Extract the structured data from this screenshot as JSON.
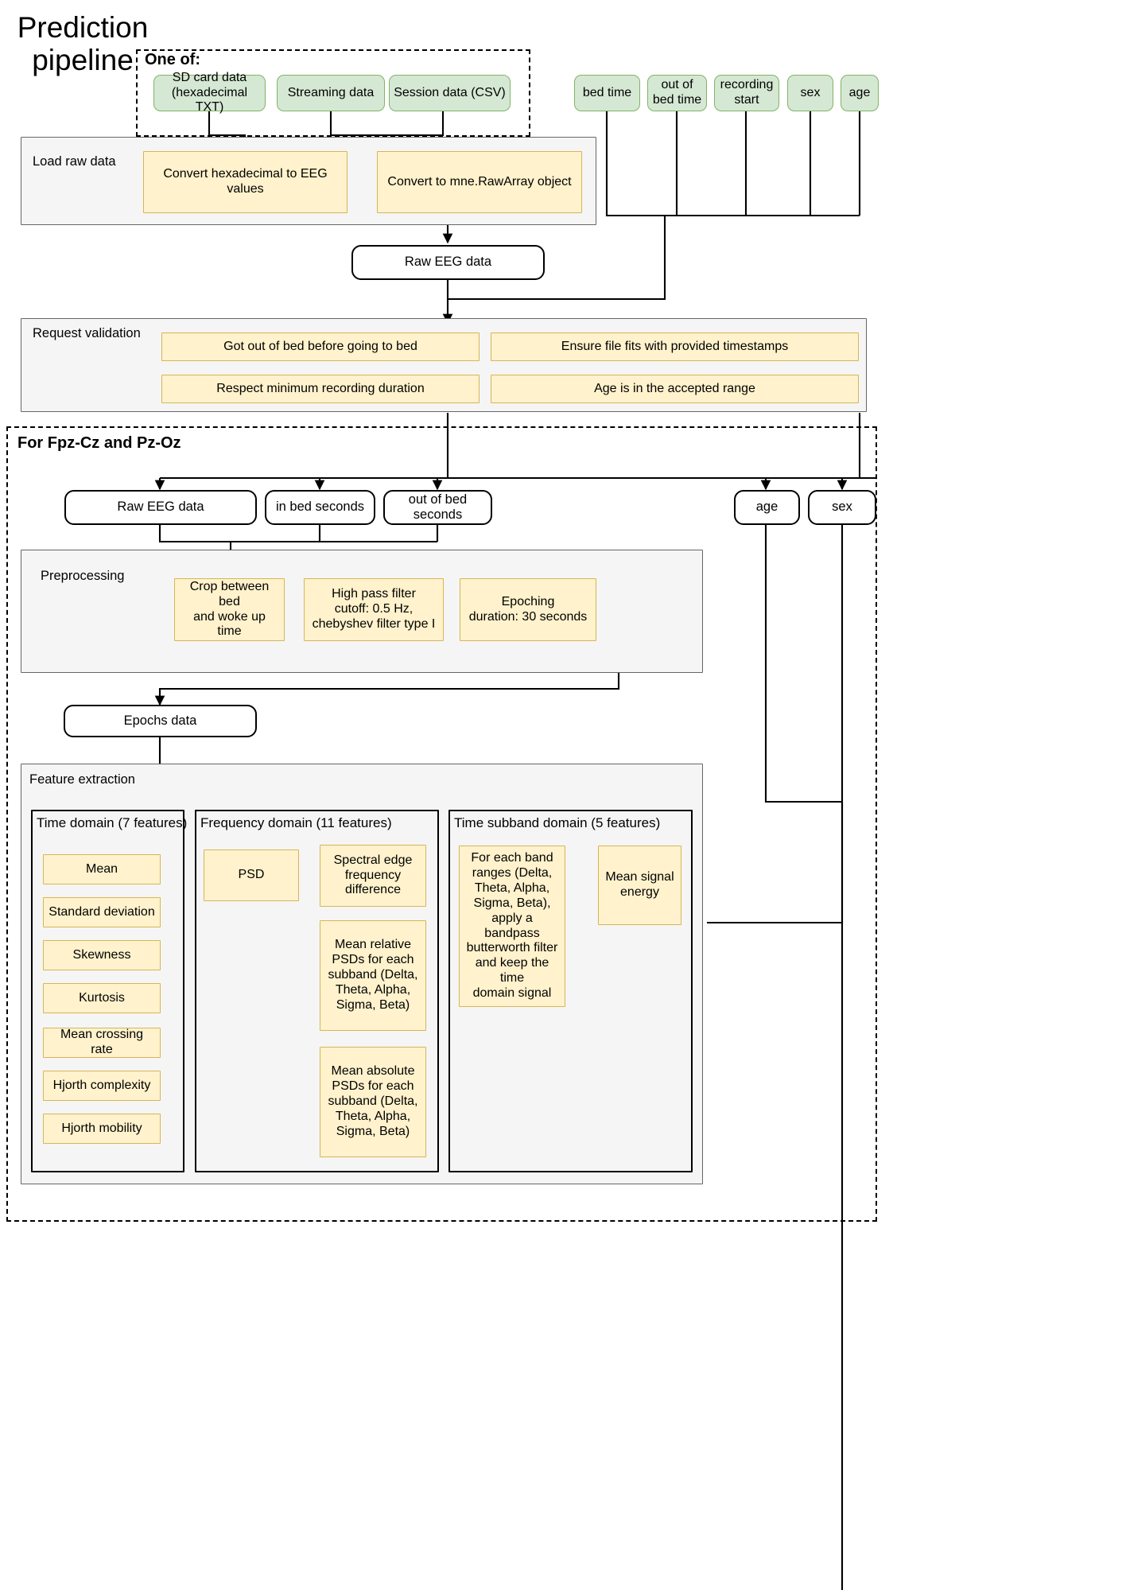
{
  "title": "Prediction\npipeline",
  "sections": {
    "one_of": "One of:",
    "load_raw_data": "Load raw data",
    "request_validation": "Request validation",
    "for_channels": "For Fpz-Cz and Pz-Oz",
    "preprocessing": "Preprocessing",
    "feature_extraction": "Feature extraction",
    "time_domain": "Time domain (7 features)",
    "frequency_domain": "Frequency domain (11 features)",
    "time_subband_domain": "Time subband domain (5 features)"
  },
  "inputs": {
    "sd_card": "SD card data\n(hexadecimal TXT)",
    "streaming": "Streaming data",
    "session": "Session data (CSV)"
  },
  "metadata": {
    "bed_time": "bed time",
    "out_of_bed_time": "out of\nbed time",
    "recording_start": "recording\nstart",
    "sex": "sex",
    "age": "age"
  },
  "load_raw": {
    "convert_hex": "Convert hexadecimal to EEG\nvalues",
    "convert_rawarray": "Convert to mne.RawArray object"
  },
  "raw_eeg_data": "Raw EEG data",
  "validation": {
    "got_out_of_bed": "Got out of bed before going to bed",
    "ensure_file_fits": "Ensure file fits with provided timestamps",
    "respect_minimum": "Respect minimum recording duration",
    "age_range": "Age is in the accepted range"
  },
  "channel_inputs": {
    "raw_eeg_data": "Raw EEG data",
    "in_bed_seconds": "in bed seconds",
    "out_of_bed_seconds": "out of bed\nseconds",
    "age": "age",
    "sex": "sex"
  },
  "preprocessing": {
    "crop": "Crop between bed\nand woke up time",
    "highpass": "High pass filter\ncutoff: 0.5 Hz,\nchebyshev filter type I",
    "epoching": "Epoching\nduration: 30 seconds"
  },
  "epochs_data": "Epochs data",
  "time_domain_features": [
    "Mean",
    "Standard deviation",
    "Skewness",
    "Kurtosis",
    "Mean crossing rate",
    "Hjorth complexity",
    "Hjorth mobility"
  ],
  "frequency_domain": {
    "psd": "PSD",
    "spectral_edge": "Spectral edge\nfrequency\ndifference",
    "mean_relative": "Mean relative\nPSDs for each\nsubband (Delta,\nTheta, Alpha,\nSigma, Beta)",
    "mean_absolute": "Mean absolute\nPSDs for each\nsubband (Delta,\nTheta, Alpha,\nSigma, Beta)"
  },
  "time_subband": {
    "bandpass": "For each band\nranges (Delta,\nTheta, Alpha,\nSigma, Beta),\napply a bandpass\nbutterworth filter\nand keep the time\ndomain signal",
    "mean_signal_energy": "Mean signal\nenergy"
  },
  "colors": {
    "green_fill": "#d5e8d4",
    "green_stroke": "#82b366",
    "yellow_fill": "#fff2cc",
    "yellow_stroke": "#d6b656",
    "group_fill": "#f5f5f5",
    "group_stroke": "#666666",
    "edge_stroke": "#000000"
  }
}
